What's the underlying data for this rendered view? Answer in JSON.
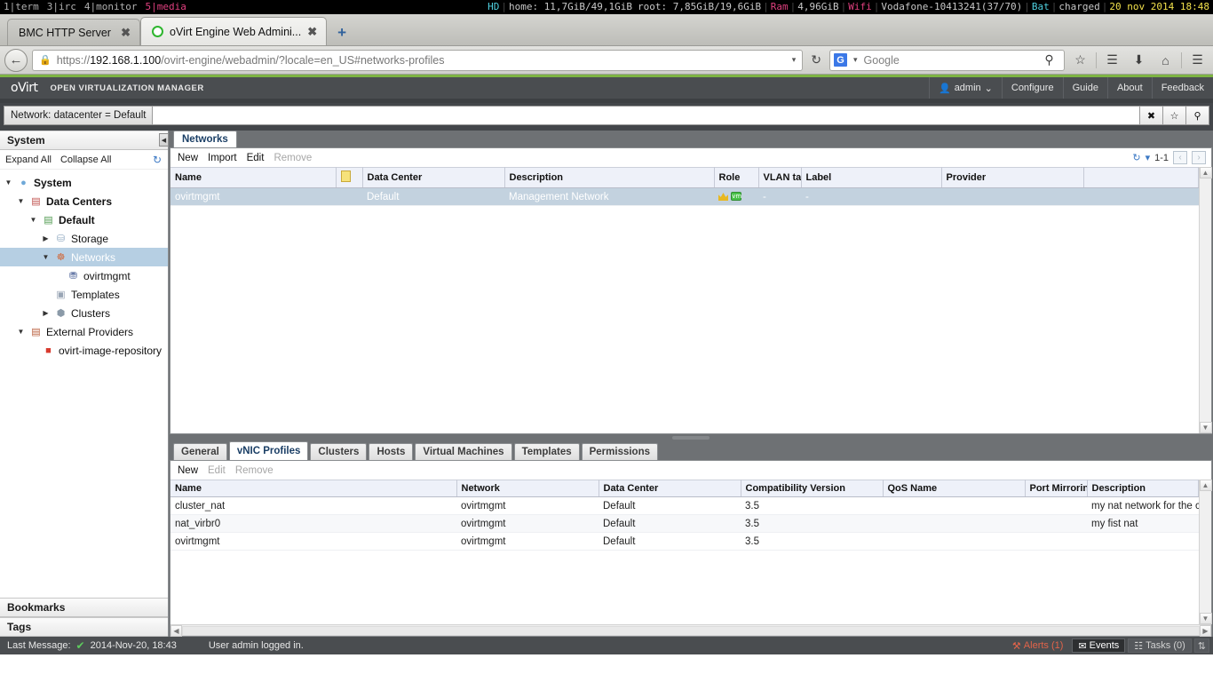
{
  "sysbar": {
    "workspaces": [
      {
        "label": "1|term",
        "selected": false
      },
      {
        "label": "3|irc",
        "selected": false
      },
      {
        "label": "4|monitor",
        "selected": false
      },
      {
        "label": "5|media",
        "selected": true
      }
    ],
    "hd_label": "HD",
    "home_label": "home: 11,7GiB/49,1GiB",
    "root_label": "root: 7,85GiB/19,6GiB",
    "ram_label": "Ram",
    "ram_value": "4,96GiB",
    "wifi_label": "Wifi",
    "wifi_value": "Vodafone-10413241(37/70)",
    "bat_label": "Bat",
    "bat_value": "charged",
    "clock": "20 nov 2014 18:48"
  },
  "browser": {
    "tabs": [
      {
        "title": "BMC HTTP Server",
        "active": false,
        "close": "✖"
      },
      {
        "title": "oVirt Engine Web Admini...",
        "active": true,
        "close": "✖"
      }
    ],
    "newtab_label": "+",
    "back_glyph": "←",
    "url_prefix": "https://",
    "url_host": "192.168.1.100",
    "url_path": "/ovirt-engine/webadmin/?locale=en_US#networks-profiles",
    "reload_glyph": "↻",
    "search_engine": "G",
    "search_placeholder": "Google",
    "icons": {
      "bookmark": "☆",
      "reader": "☰",
      "download": "⬇",
      "home": "⌂",
      "menu": "☰"
    }
  },
  "ovirt_header": {
    "logo_o": "o",
    "logo_virt": "Virt",
    "tagline": "OPEN VIRTUALIZATION MANAGER",
    "menu": [
      {
        "label": "admin",
        "icon": "user-icon",
        "caret": "⌄"
      },
      {
        "label": "Configure"
      },
      {
        "label": "Guide"
      },
      {
        "label": "About"
      },
      {
        "label": "Feedback"
      }
    ]
  },
  "search": {
    "prefix": "Network: datacenter = Default",
    "value": "",
    "placeholder": "",
    "buttons": [
      {
        "name": "clear-search-button",
        "glyph": "✖"
      },
      {
        "name": "bookmark-search-button",
        "glyph": "☆"
      },
      {
        "name": "run-search-button",
        "glyph": "⚲"
      }
    ]
  },
  "sidebar": {
    "system_header": "System",
    "collapse_glyph": "◀",
    "expand_all": "Expand All",
    "collapse_all": "Collapse All",
    "refresh_glyph": "↻",
    "tree": [
      {
        "label": "System",
        "indent": 0,
        "twist": "▼",
        "icon": "globe-icon",
        "glyph": "●",
        "color": "#6fa8d8",
        "bold": true,
        "selected": false
      },
      {
        "label": "Data Centers",
        "indent": 1,
        "twist": "▼",
        "icon": "datacenters-icon",
        "glyph": "▤",
        "color": "#c0504d",
        "bold": true,
        "selected": false
      },
      {
        "label": "Default",
        "indent": 2,
        "twist": "▼",
        "icon": "datacenter-icon",
        "glyph": "▤",
        "color": "#4f9a4f",
        "bold": true,
        "selected": false
      },
      {
        "label": "Storage",
        "indent": 3,
        "twist": "▶",
        "icon": "storage-icon",
        "glyph": "⛁",
        "color": "#8fa8c0",
        "bold": false,
        "selected": false
      },
      {
        "label": "Networks",
        "indent": 3,
        "twist": "▼",
        "icon": "network-icon",
        "glyph": "☸",
        "color": "#d06a3c",
        "bold": false,
        "selected": true
      },
      {
        "label": "ovirtmgmt",
        "indent": 4,
        "twist": "",
        "icon": "network-leaf-icon",
        "glyph": "⛃",
        "color": "#5a6fa0",
        "bold": false,
        "selected": false
      },
      {
        "label": "Templates",
        "indent": 3,
        "twist": "",
        "icon": "templates-icon",
        "glyph": "▣",
        "color": "#9aa6b5",
        "bold": false,
        "selected": false
      },
      {
        "label": "Clusters",
        "indent": 3,
        "twist": "▶",
        "icon": "clusters-icon",
        "glyph": "⬢",
        "color": "#8b9aa8",
        "bold": false,
        "selected": false
      },
      {
        "label": "External Providers",
        "indent": 1,
        "twist": "▼",
        "icon": "external-providers-icon",
        "glyph": "▤",
        "color": "#b85c3a",
        "bold": false,
        "selected": false
      },
      {
        "label": "ovirt-image-repository",
        "indent": 2,
        "twist": "",
        "icon": "image-repository-icon",
        "glyph": "■",
        "color": "#d83a2e",
        "bold": false,
        "selected": false
      }
    ],
    "bookmarks_header": "Bookmarks",
    "tags_header": "Tags"
  },
  "main_tab": {
    "label": "Networks"
  },
  "networks_grid": {
    "toolbar": [
      {
        "label": "New",
        "disabled": false
      },
      {
        "label": "Import",
        "disabled": false
      },
      {
        "label": "Edit",
        "disabled": false
      },
      {
        "label": "Remove",
        "disabled": true
      }
    ],
    "pager": {
      "refresh_glyph": "↻",
      "caret": "▾",
      "range": "1-1",
      "prev": "‹",
      "next": "›"
    },
    "columns": [
      "Name",
      "",
      "Data Center",
      "Description",
      "Role",
      "VLAN tag",
      "Label",
      "Provider",
      ""
    ],
    "rows": [
      {
        "name": "ovirtmgmt",
        "flag": "",
        "data_center": "Default",
        "description": "Management Network",
        "role": "crown+vm",
        "vlan_tag": "-",
        "label": "-",
        "provider": "",
        "selected": true
      }
    ]
  },
  "detail_tabs": [
    {
      "label": "General",
      "active": false
    },
    {
      "label": "vNIC Profiles",
      "active": true
    },
    {
      "label": "Clusters",
      "active": false
    },
    {
      "label": "Hosts",
      "active": false
    },
    {
      "label": "Virtual Machines",
      "active": false
    },
    {
      "label": "Templates",
      "active": false
    },
    {
      "label": "Permissions",
      "active": false
    }
  ],
  "vnic_grid": {
    "toolbar": [
      {
        "label": "New",
        "disabled": false
      },
      {
        "label": "Edit",
        "disabled": true
      },
      {
        "label": "Remove",
        "disabled": true
      }
    ],
    "columns": [
      "Name",
      "Network",
      "Data Center",
      "Compatibility Version",
      "QoS Name",
      "Port Mirroring",
      "Description"
    ],
    "rows": [
      {
        "name": "cluster_nat",
        "network": "ovirtmgmt",
        "data_center": "Default",
        "compatibility_version": "3.5",
        "qos_name": "",
        "port_mirroring": "",
        "description": "my nat network for the clu"
      },
      {
        "name": "nat_virbr0",
        "network": "ovirtmgmt",
        "data_center": "Default",
        "compatibility_version": "3.5",
        "qos_name": "",
        "port_mirroring": "",
        "description": "my fist nat"
      },
      {
        "name": "ovirtmgmt",
        "network": "ovirtmgmt",
        "data_center": "Default",
        "compatibility_version": "3.5",
        "qos_name": "",
        "port_mirroring": "",
        "description": ""
      }
    ]
  },
  "statusbar": {
    "last_message_label": "Last Message:",
    "check_glyph": "✔",
    "timestamp": "2014-Nov-20, 18:43",
    "message": "User admin logged in.",
    "alerts_label": "Alerts (1)",
    "alerts_icon": "⚒",
    "events_label": "Events",
    "events_icon": "✉",
    "tasks_label": "Tasks (0)",
    "tasks_icon": "☷",
    "updown_glyph": "⇅"
  }
}
